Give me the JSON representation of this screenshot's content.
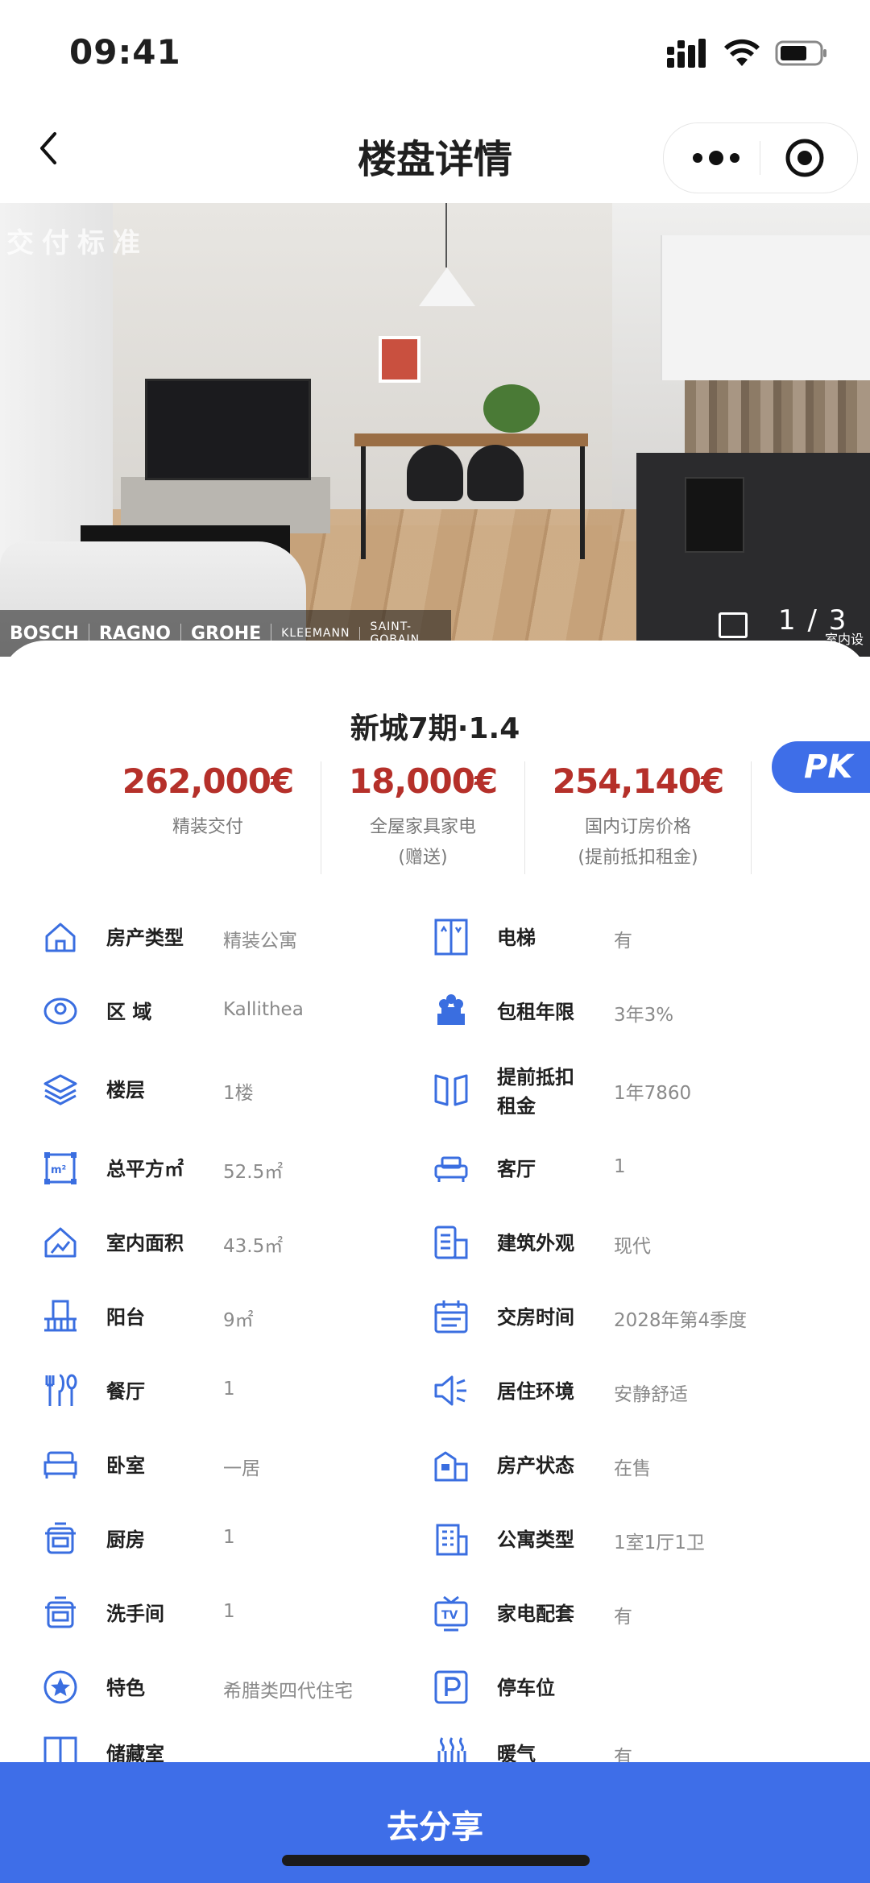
{
  "status_bar": {
    "time": "09:41",
    "signal_icon": "signal-icon",
    "wifi_icon": "wifi-icon",
    "battery_icon": "battery-icon"
  },
  "nav": {
    "title": "楼盘详情",
    "back_icon": "chevron-left-icon",
    "more_icon": "more-dots-icon",
    "close_icon": "target-icon"
  },
  "hero": {
    "overlay_text": "交付标准",
    "brands": [
      "BOSCH",
      "RAGNO",
      "GROHE",
      "KLEEMANN",
      "SAINT-GOBAIN"
    ],
    "counter": "1 / 3",
    "caption": "室内设",
    "photo_icon": "image-icon"
  },
  "property": {
    "title": "新城7期·1.4",
    "prices": [
      {
        "value": "262,000€",
        "label": "精装交付"
      },
      {
        "value": "18,000€",
        "label": "全屋家具家电",
        "label2": "(赠送)"
      },
      {
        "value": "254,140€",
        "label": "国内订房价格",
        "label2": "(提前抵扣租金)"
      }
    ],
    "pk_label": "PK"
  },
  "specs_left": [
    {
      "icon": "house-icon",
      "key": "房产类型",
      "value": "精装公寓"
    },
    {
      "icon": "location-icon",
      "key": "区 域",
      "value": "Kallithea"
    },
    {
      "icon": "layers-icon",
      "key": "楼层",
      "value": "1楼"
    },
    {
      "icon": "area-icon",
      "key": "总平方㎡",
      "value": "52.5㎡"
    },
    {
      "icon": "indoor-icon",
      "key": "室内面积",
      "value": "43.5㎡"
    },
    {
      "icon": "balcony-icon",
      "key": "阳台",
      "value": "9㎡"
    },
    {
      "icon": "dining-icon",
      "key": "餐厅",
      "value": "1"
    },
    {
      "icon": "bed-icon",
      "key": "卧室",
      "value": "一居"
    },
    {
      "icon": "kitchen-icon",
      "key": "厨房",
      "value": "1"
    },
    {
      "icon": "washroom-icon",
      "key": "洗手间",
      "value": "1"
    },
    {
      "icon": "star-icon",
      "key": "特色",
      "value": "希腊类四代住宅"
    },
    {
      "icon": "storage-icon",
      "key": "储藏室",
      "value": ""
    }
  ],
  "specs_right": [
    {
      "icon": "elevator-icon",
      "key": "电梯",
      "value": "有"
    },
    {
      "icon": "lease-icon",
      "key": "包租年限",
      "value": "3年3%"
    },
    {
      "icon": "book-icon",
      "key": "提前抵扣",
      "key2": "租金",
      "value": "1年7860"
    },
    {
      "icon": "sofa-icon",
      "key": "客厅",
      "value": "1"
    },
    {
      "icon": "building-icon",
      "key": "建筑外观",
      "value": "现代"
    },
    {
      "icon": "calendar-icon",
      "key": "交房时间",
      "value": "2028年第4季度"
    },
    {
      "icon": "sound-icon",
      "key": "居住环境",
      "value": "安静舒适"
    },
    {
      "icon": "property-status-icon",
      "key": "房产状态",
      "value": "在售"
    },
    {
      "icon": "apartment-icon",
      "key": "公寓类型",
      "value": "1室1厅1卫"
    },
    {
      "icon": "tv-icon",
      "key": "家电配套",
      "value": "有"
    },
    {
      "icon": "parking-icon",
      "key": "停车位",
      "value": ""
    },
    {
      "icon": "heating-icon",
      "key": "暖气",
      "value": "有"
    }
  ],
  "bottom": {
    "share_label": "去分享"
  },
  "colors": {
    "accent": "#3e6ee8",
    "price": "#b5302a",
    "icon": "#3a6ee0"
  }
}
